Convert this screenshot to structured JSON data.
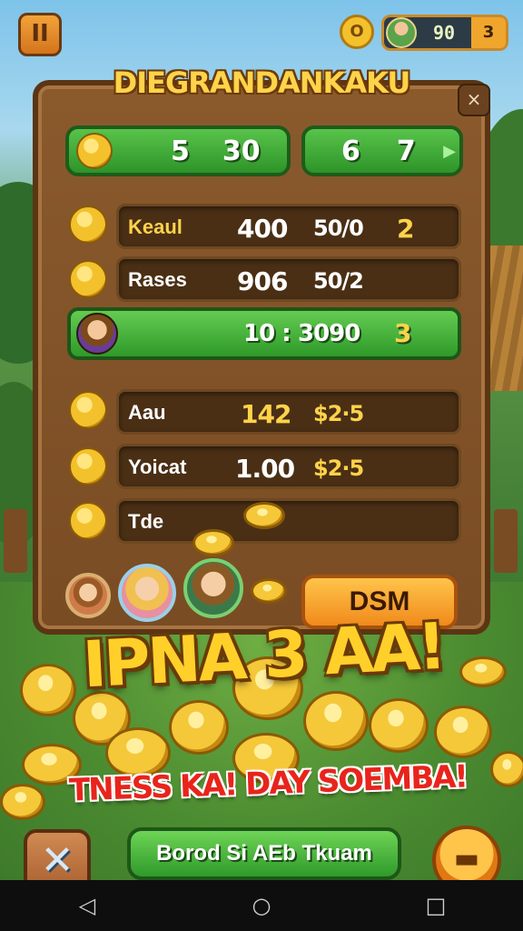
{
  "top_bar": {
    "pause_label": "II",
    "settings_label": "O",
    "currency_value": "90",
    "currency_badge": "3"
  },
  "panel": {
    "title": "DIEGRANDANKAKU",
    "close_label": "×"
  },
  "stats": [
    {
      "a": "5",
      "b": "30"
    },
    {
      "a": "6",
      "b": "7"
    }
  ],
  "rows": [
    {
      "label": "Keaul",
      "value1": "400",
      "value2": "50/0",
      "value3": "2"
    },
    {
      "label": "Rases",
      "value1": "906",
      "value2": "50/2",
      "value3": ""
    },
    {
      "label": "",
      "value1": "10 :",
      "value2": "3090",
      "value3": "3"
    },
    {
      "label": "Aau",
      "value1": "142",
      "value2": "$2·5",
      "value3": ""
    },
    {
      "label": "Yoicat",
      "value1": "1.00",
      "value2": "$2·5",
      "value3": ""
    },
    {
      "label": "Tde",
      "value1": "",
      "value2": "",
      "value3": ""
    }
  ],
  "dsm_button": "DSM",
  "headline": "IPNA 3 AA!",
  "subheadline": "TNESS KA! DAY SOEMBA!",
  "share_button": "Borod Si AEb Tkuam",
  "close_button": "✕",
  "chest_button": "▬",
  "nav": {
    "back": "◁",
    "home": "○",
    "recents": "□"
  },
  "colors": {
    "wood": "#7a4c24",
    "green_button": "#2f9a2a",
    "gold": "#f3c12c",
    "headline_yellow": "#ffd02a",
    "headline_red": "#e8241c"
  }
}
